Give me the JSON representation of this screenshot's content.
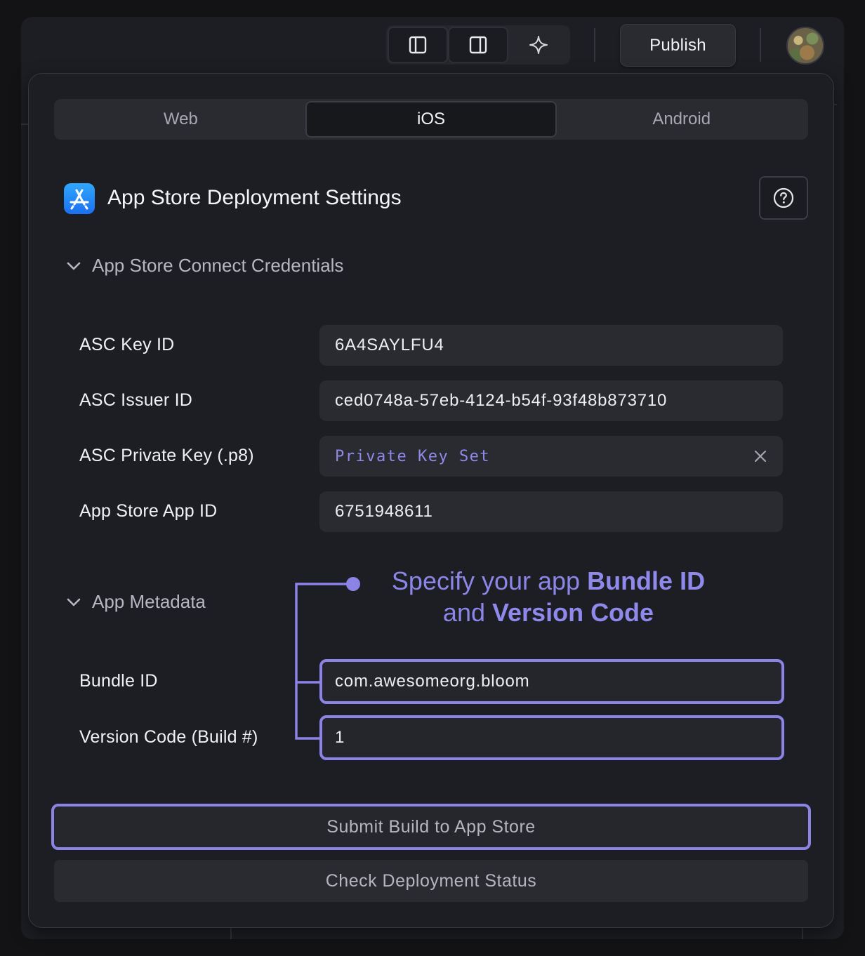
{
  "toolbar": {
    "buttons": [
      {
        "icon": "left-sidebar-toggle-icon"
      },
      {
        "icon": "right-sidebar-toggle-icon"
      },
      {
        "icon": "sparkle-icon"
      }
    ],
    "publish_label": "Publish"
  },
  "tabs": [
    {
      "label": "Web",
      "active": false
    },
    {
      "label": "iOS",
      "active": true
    },
    {
      "label": "Android",
      "active": false
    }
  ],
  "panel": {
    "title": "App Store Deployment Settings",
    "icon": "app-store-icon",
    "help_icon": "help-circle-icon"
  },
  "credentials": {
    "section_title": "App Store Connect Credentials",
    "fields": [
      {
        "label": "ASC Key ID",
        "value": "6A4SAYLFU4"
      },
      {
        "label": "ASC Issuer ID",
        "value": "ced0748a-57eb-4124-b54f-93f48b873710"
      },
      {
        "label": "ASC Private Key (.p8)",
        "value": "Private Key Set"
      },
      {
        "label": "App Store App ID",
        "value": "6751948611"
      }
    ]
  },
  "metadata": {
    "section_title": "App Metadata",
    "fields": [
      {
        "label": "Bundle ID",
        "value": "com.awesomeorg.bloom"
      },
      {
        "label": "Version Code (Build #)",
        "value": "1"
      }
    ]
  },
  "callout": {
    "prefix": "Specify your app ",
    "bold1": "Bundle ID",
    "middle": "and ",
    "bold2": "Version Code"
  },
  "actions": {
    "submit_label": "Submit Build to App Store",
    "status_label": "Check Deployment Status"
  },
  "colors": {
    "accent": "#8b84e6",
    "background": "#1d1e24",
    "field_bg": "#2a2b31"
  }
}
